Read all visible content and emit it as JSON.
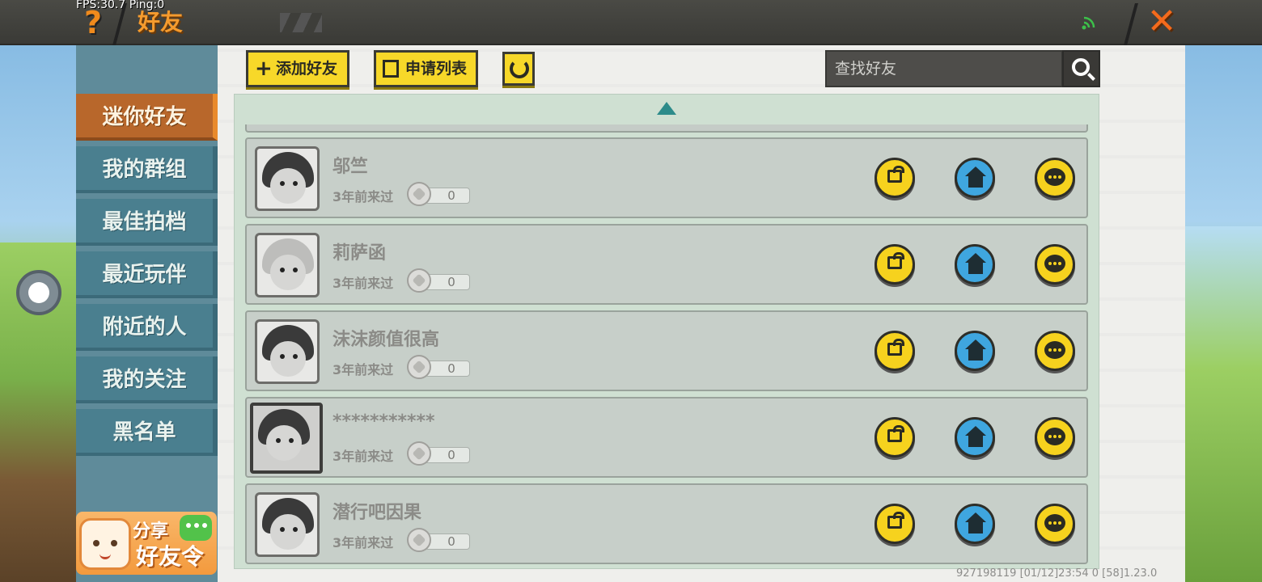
{
  "status": {
    "fps": "FPS:30.7  Ping:0"
  },
  "header": {
    "title": "好友",
    "help_icon": "question-mark-icon",
    "close_icon": "close-x-icon"
  },
  "sidebar": {
    "tabs": [
      {
        "label": "迷你好友",
        "active": true
      },
      {
        "label": "我的群组",
        "active": false
      },
      {
        "label": "最佳拍档",
        "active": false
      },
      {
        "label": "最近玩伴",
        "active": false
      },
      {
        "label": "附近的人",
        "active": false
      },
      {
        "label": "我的关注",
        "active": false
      },
      {
        "label": "黑名单",
        "active": false
      }
    ],
    "share_banner": {
      "line1": "分享",
      "line2": "好友令"
    }
  },
  "toolbar": {
    "add_friend_label": "添加好友",
    "request_list_label": "申请列表",
    "search_placeholder": "查找好友"
  },
  "friends": [
    {
      "name": "邬竺",
      "last_seen": "3年前来过",
      "intimacy": "0"
    },
    {
      "name": "莉萨函",
      "last_seen": "3年前来过",
      "intimacy": "0"
    },
    {
      "name": "沫沫颜值很高",
      "last_seen": "3年前来过",
      "intimacy": "0"
    },
    {
      "name": "***********",
      "last_seen": "3年前来过",
      "intimacy": "0"
    },
    {
      "name": "潜行吧因果",
      "last_seen": "3年前来过",
      "intimacy": "0"
    }
  ],
  "footer": {
    "info": "927198119  [01/12]23:54 0  [58]1.23.0"
  },
  "colors": {
    "accent_yellow": "#f6d21e",
    "accent_blue": "#3fa6df",
    "active_tab": "#b8672b",
    "tab": "#4a7f8f",
    "title_orange": "#f59b2e"
  }
}
